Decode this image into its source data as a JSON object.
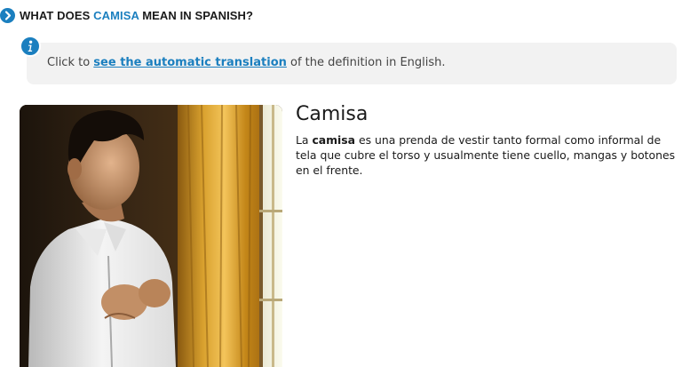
{
  "section": {
    "title_prefix": "WHAT DOES ",
    "title_word": "CAMISA",
    "title_suffix": " MEAN IN SPANISH?"
  },
  "info": {
    "text_prefix": "Click to ",
    "link_text": "see the automatic translation",
    "text_suffix": " of the definition in English."
  },
  "entry": {
    "word": "Camisa",
    "definition_prefix": "La ",
    "definition_term": "camisa",
    "definition_rest": " es una prenda de vestir tanto formal como informal de tela que cubre el torso y usualmente tiene cuello, mangas y botones en el frente."
  },
  "colors": {
    "accent": "#1b7fbf",
    "info_background": "#f2f2f2"
  }
}
